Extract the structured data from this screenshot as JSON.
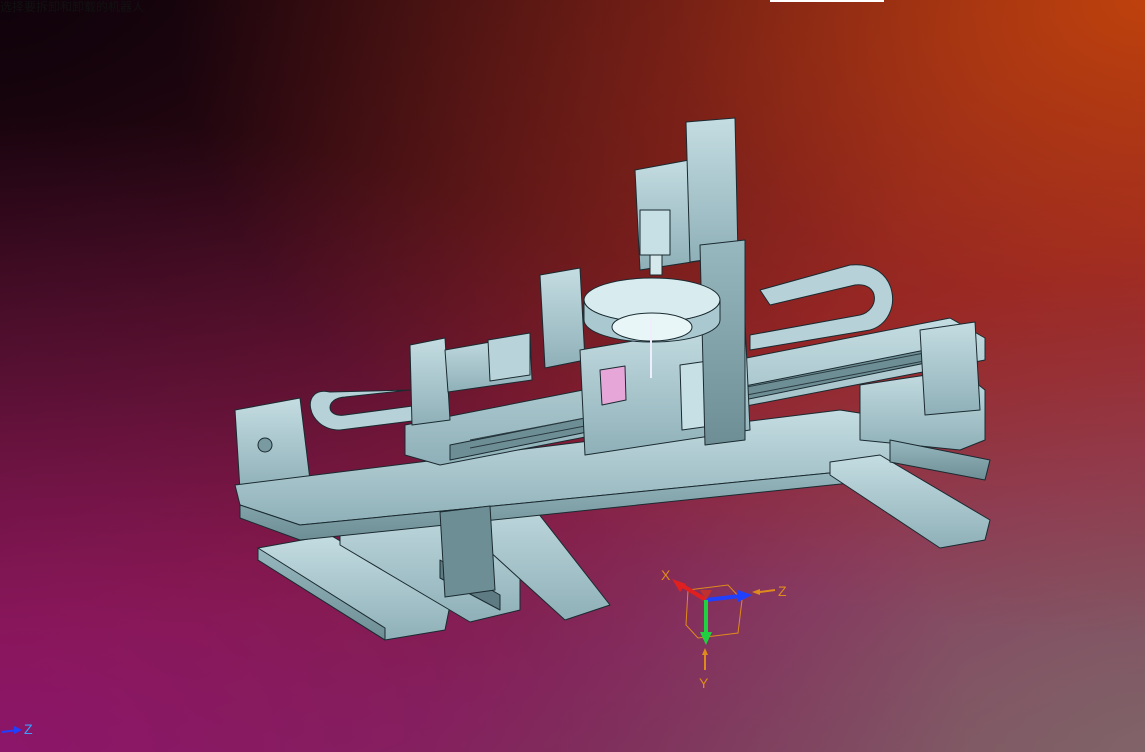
{
  "hint_text": "选择要拆卸和卸载的机器人",
  "triad": {
    "x_label": "X",
    "y_label": "Y",
    "z_label": "Z"
  },
  "mini_triad": {
    "z_label": "Z"
  },
  "colors": {
    "model_fill": "#a9c8cf",
    "model_shadow": "#7a9aa2",
    "model_edge": "#1a2a30",
    "axis_x": "#e02020",
    "axis_y": "#20d040",
    "axis_z": "#2040ff",
    "label": "#e08a1e"
  },
  "icons": [
    "cad-model",
    "view-triad",
    "mini-axis-triad"
  ]
}
